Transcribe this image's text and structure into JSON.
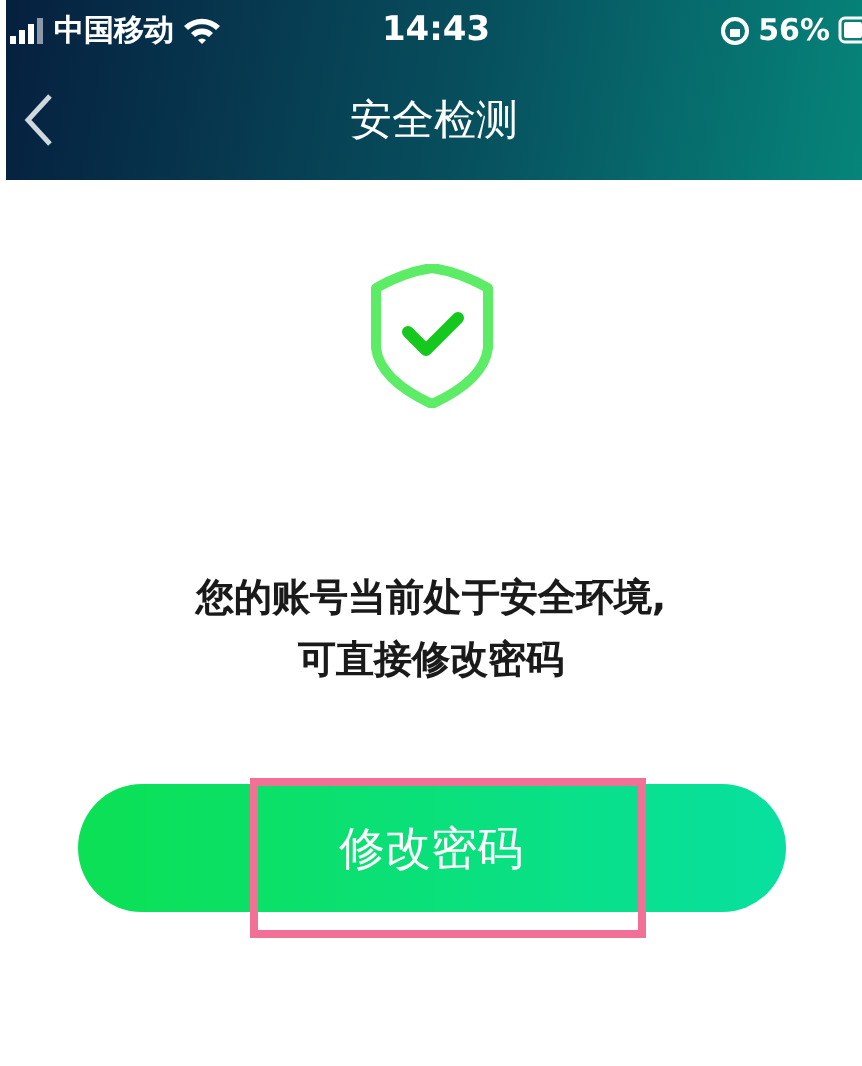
{
  "status_bar": {
    "carrier": "中国移动",
    "time": "14:43",
    "battery": "56%"
  },
  "header": {
    "title": "安全检测"
  },
  "message": {
    "lines": [
      "您的账号当前处于安全环境,",
      "可直接修改密码"
    ]
  },
  "button": {
    "label": "修改密码",
    "highlighted": true
  }
}
